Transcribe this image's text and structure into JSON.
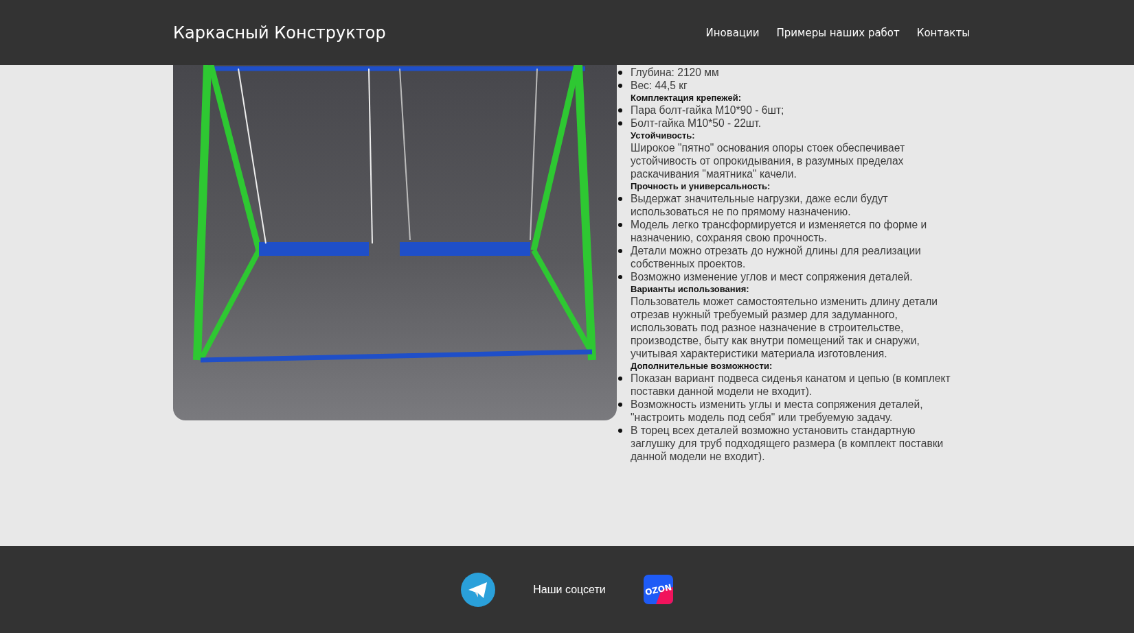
{
  "header": {
    "title": "Каркасный Конструктор",
    "nav": [
      {
        "label": "Иновации"
      },
      {
        "label": "Примеры наших работ"
      },
      {
        "label": "Контакты"
      }
    ]
  },
  "specs": [
    {
      "kind": "bullet",
      "text": "Глубина: 2120 мм"
    },
    {
      "kind": "bullet",
      "text": "Вес: 44,5 кг"
    },
    {
      "kind": "heading",
      "text": "Комплектация крепежей:"
    },
    {
      "kind": "bullet",
      "text": "Пара болт-гайка М10*90 - 6шт;"
    },
    {
      "kind": "bullet",
      "text": "Болт-гайка М10*50 - 22шт."
    },
    {
      "kind": "heading",
      "text": "Устойчивость:"
    },
    {
      "kind": "paragraph",
      "text": "Широкое \"пятно\" основания опоры стоек обеспечивает устойчивость от опрокидывания, в разумных пределах раскачивания \"маятника\" качели."
    },
    {
      "kind": "heading",
      "text": "Прочность и универсальность:"
    },
    {
      "kind": "bullet",
      "text": "Выдержат значительные нагрузки, даже если будут использоваться не по прямому назначению."
    },
    {
      "kind": "bullet",
      "text": "Модель легко трансформируется и изменяется по форме и назначению, сохраняя свою прочность."
    },
    {
      "kind": "bullet",
      "text": "Детали можно отрезать до нужной длины для реализации собственных проектов."
    },
    {
      "kind": "bullet",
      "text": "Возможно изменение углов и мест сопряжения деталей."
    },
    {
      "kind": "heading",
      "text": "Варианты использования:"
    },
    {
      "kind": "paragraph",
      "text": "Пользователь может самостоятельно изменить длину детали отрезав нужный требуемый размер для задуманного, использовать под разное назначение в строительстве, производстве, быту как внутри помещений так и снаружи, учитывая характеристики материала изготовления."
    },
    {
      "kind": "heading",
      "text": "Дополнительные возможности:"
    },
    {
      "kind": "bullet",
      "text": "Показан вариант подвеса сиденья канатом и цепью (в комплект поставки данной модели не входит)."
    },
    {
      "kind": "bullet",
      "text": "Возможность изменить углы и места сопряжения деталей, \"настроить модель под себя\" или требуемую задачу."
    },
    {
      "kind": "bullet",
      "text": "В торец всех деталей возможно установить стандартную заглушку для труб подходящего размера (в комплект поставки данной модели не входит)."
    }
  ],
  "footer": {
    "label": "Наши соцсети",
    "ozon_logo_text": "OZON"
  }
}
